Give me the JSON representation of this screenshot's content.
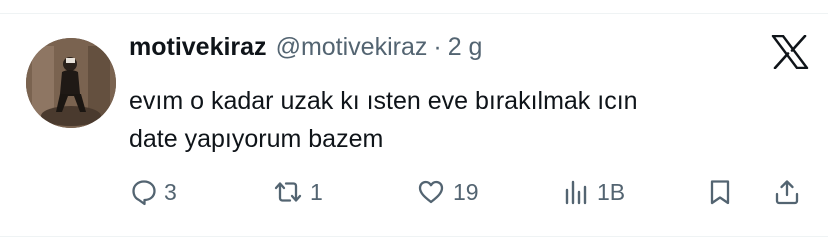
{
  "tweet": {
    "display_name": "motivekiraz",
    "handle": "@motivekiraz",
    "separator": "·",
    "time": "2 g",
    "text_lines": [
      "evım o kadar uzak kı ısten eve bırakılmak ıcın",
      "date yapıyorum bazem"
    ]
  },
  "icons": {
    "logo": "x-logo-icon",
    "reply": "reply-icon",
    "retweet": "retweet-icon",
    "like": "heart-icon",
    "views": "views-icon",
    "bookmark": "bookmark-icon",
    "share": "share-icon"
  },
  "actions": {
    "reply_count": "3",
    "retweet_count": "1",
    "like_count": "19",
    "view_count": "1B"
  },
  "colors": {
    "text": "#0f1419",
    "secondary": "#536471",
    "divider": "#eff3f4"
  }
}
